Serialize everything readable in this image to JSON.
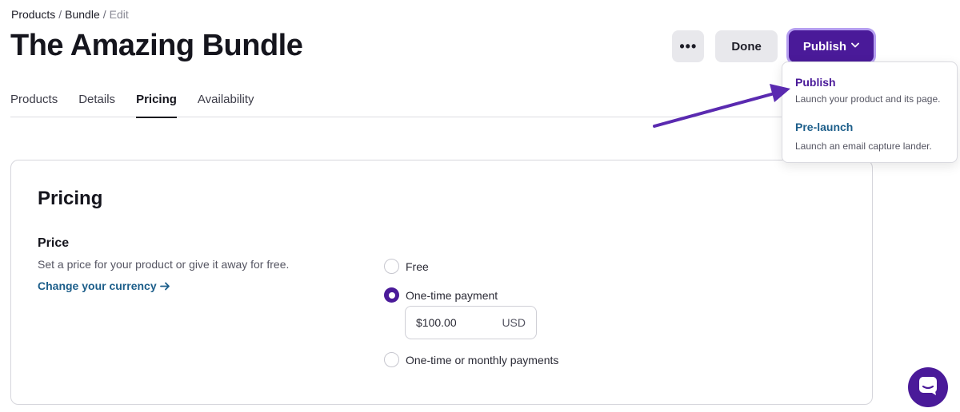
{
  "breadcrumb": {
    "items": [
      "Products",
      "Bundle"
    ],
    "current": "Edit",
    "separator": "/"
  },
  "page": {
    "title": "The Amazing Bundle"
  },
  "header": {
    "more_label": "•••",
    "done_label": "Done",
    "publish_label": "Publish"
  },
  "tabs": [
    {
      "label": "Products",
      "active": false
    },
    {
      "label": "Details",
      "active": false
    },
    {
      "label": "Pricing",
      "active": true
    },
    {
      "label": "Availability",
      "active": false
    }
  ],
  "pricing": {
    "title": "Pricing",
    "price_label": "Price",
    "description": "Set a price for your product or give it away for free.",
    "currency_link": "Change your currency",
    "options": [
      {
        "label": "Free",
        "selected": false
      },
      {
        "label": "One-time payment",
        "selected": true
      },
      {
        "label": "One-time or monthly payments",
        "selected": false
      }
    ],
    "price_value": "$100.00",
    "currency": "USD"
  },
  "publish_menu": {
    "items": [
      {
        "title": "Publish",
        "description": "Launch your product and its page."
      },
      {
        "title": "Pre-launch",
        "description": "Launch an email capture lander."
      }
    ]
  },
  "colors": {
    "accent": "#4a1a99",
    "link": "#1c5e8a",
    "prelaunch": "#1c5e8a"
  },
  "icons": {
    "publish_chevron": "chevron-down-icon",
    "currency_arrow": "arrow-right-icon",
    "chat": "chat-icon"
  }
}
